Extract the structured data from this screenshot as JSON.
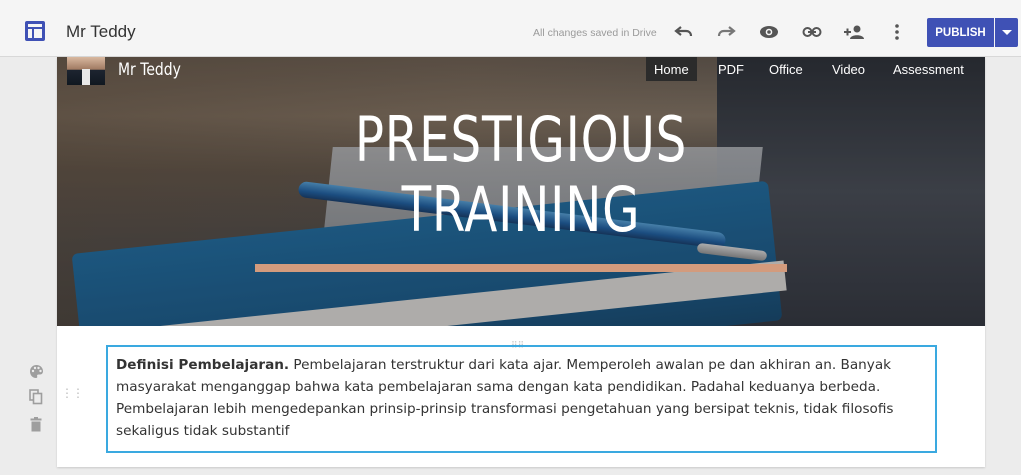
{
  "toolbar": {
    "site_title": "Mr Teddy",
    "saved_status": "All changes saved in Drive",
    "publish_label": "PUBLISH",
    "icons": [
      "sites-logo-icon",
      "undo-icon",
      "redo-icon",
      "preview-icon",
      "link-icon",
      "share-icon",
      "more-icon",
      "publish-dropdown-icon"
    ]
  },
  "side_tools": [
    "palette-icon",
    "duplicate-icon",
    "delete-icon"
  ],
  "header": {
    "site_name": "Mr Teddy",
    "nav": [
      {
        "label": "Home",
        "active": true
      },
      {
        "label": "PDF",
        "active": false
      },
      {
        "label": "Office",
        "active": false
      },
      {
        "label": "Video",
        "active": false
      },
      {
        "label": "Assessment",
        "active": false
      }
    ],
    "title_line1": "PRESTIGIOUS",
    "title_line2": "TRAINING",
    "bar_color": "#d39b7d"
  },
  "content": {
    "bold_lead": "Definisi Pembelajaran.",
    "paragraph": " Pembelajaran terstruktur dari kata ajar. Memperoleh awalan pe dan akhiran an. Banyak masyarakat menganggap bahwa kata pembelajaran sama dengan kata pendidikan. Padahal keduanya berbeda. Pembelajaran lebih mengedepankan prinsip-prinsip transformasi pengetahuan yang bersipat teknis, tidak filosofis sekaligus tidak substantif"
  },
  "colors": {
    "accent": "#3f51b5",
    "selection": "#3aa9e0"
  }
}
